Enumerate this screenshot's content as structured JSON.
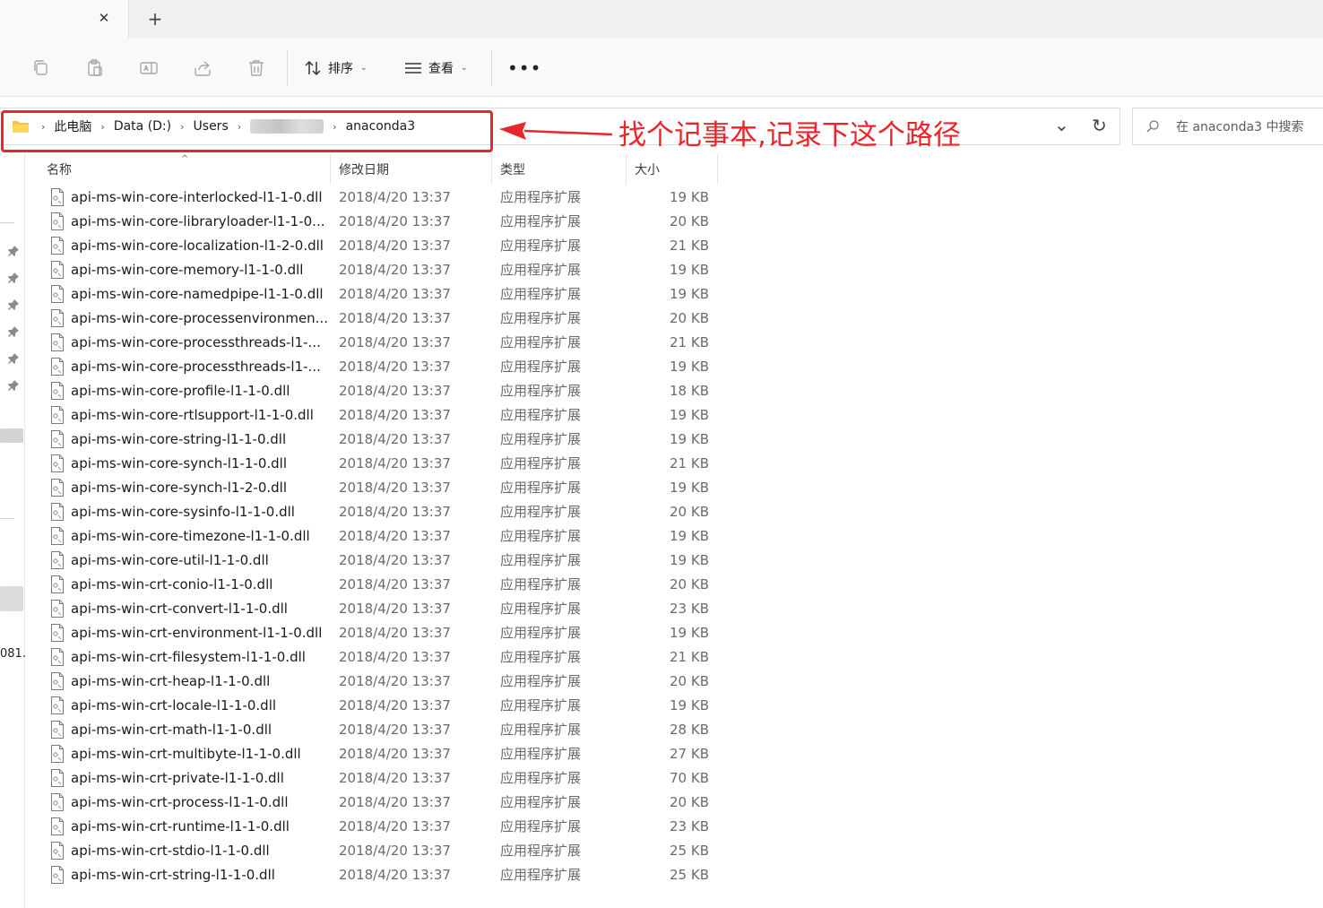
{
  "tabbar": {
    "close_glyph": "✕",
    "new_tab_glyph": "+"
  },
  "toolbar": {
    "buttons": [
      {
        "name": "copy",
        "icon": "copy-icon"
      },
      {
        "name": "paste",
        "icon": "paste-icon"
      },
      {
        "name": "rename",
        "icon": "rename-icon"
      },
      {
        "name": "share",
        "icon": "share-icon"
      },
      {
        "name": "delete",
        "icon": "trash-icon"
      }
    ],
    "sort_label": "排序",
    "view_label": "查看",
    "more_glyph": "•••"
  },
  "address": {
    "crumbs": [
      "此电脑",
      "Data (D:)",
      "Users",
      "anaconda3"
    ],
    "separator": "›",
    "chevron_glyph": "⌄",
    "refresh_glyph": "↻"
  },
  "annotation": {
    "text": "找个记事本,记录下这个路径",
    "color": "#e8262b"
  },
  "search": {
    "placeholder": "在 anaconda3 中搜索"
  },
  "nav": {
    "partial_text": "081."
  },
  "columns": {
    "name": "名称",
    "modified": "修改日期",
    "type": "类型",
    "size": "大小"
  },
  "files": [
    {
      "name": "api-ms-win-core-interlocked-l1-1-0.dll",
      "date": "2018/4/20 13:37",
      "type": "应用程序扩展",
      "size": "19 KB"
    },
    {
      "name": "api-ms-win-core-libraryloader-l1-1-0...",
      "date": "2018/4/20 13:37",
      "type": "应用程序扩展",
      "size": "20 KB"
    },
    {
      "name": "api-ms-win-core-localization-l1-2-0.dll",
      "date": "2018/4/20 13:37",
      "type": "应用程序扩展",
      "size": "21 KB"
    },
    {
      "name": "api-ms-win-core-memory-l1-1-0.dll",
      "date": "2018/4/20 13:37",
      "type": "应用程序扩展",
      "size": "19 KB"
    },
    {
      "name": "api-ms-win-core-namedpipe-l1-1-0.dll",
      "date": "2018/4/20 13:37",
      "type": "应用程序扩展",
      "size": "19 KB"
    },
    {
      "name": "api-ms-win-core-processenvironmen...",
      "date": "2018/4/20 13:37",
      "type": "应用程序扩展",
      "size": "20 KB"
    },
    {
      "name": "api-ms-win-core-processthreads-l1-...",
      "date": "2018/4/20 13:37",
      "type": "应用程序扩展",
      "size": "21 KB"
    },
    {
      "name": "api-ms-win-core-processthreads-l1-...",
      "date": "2018/4/20 13:37",
      "type": "应用程序扩展",
      "size": "19 KB"
    },
    {
      "name": "api-ms-win-core-profile-l1-1-0.dll",
      "date": "2018/4/20 13:37",
      "type": "应用程序扩展",
      "size": "18 KB"
    },
    {
      "name": "api-ms-win-core-rtlsupport-l1-1-0.dll",
      "date": "2018/4/20 13:37",
      "type": "应用程序扩展",
      "size": "19 KB"
    },
    {
      "name": "api-ms-win-core-string-l1-1-0.dll",
      "date": "2018/4/20 13:37",
      "type": "应用程序扩展",
      "size": "19 KB"
    },
    {
      "name": "api-ms-win-core-synch-l1-1-0.dll",
      "date": "2018/4/20 13:37",
      "type": "应用程序扩展",
      "size": "21 KB"
    },
    {
      "name": "api-ms-win-core-synch-l1-2-0.dll",
      "date": "2018/4/20 13:37",
      "type": "应用程序扩展",
      "size": "19 KB"
    },
    {
      "name": "api-ms-win-core-sysinfo-l1-1-0.dll",
      "date": "2018/4/20 13:37",
      "type": "应用程序扩展",
      "size": "20 KB"
    },
    {
      "name": "api-ms-win-core-timezone-l1-1-0.dll",
      "date": "2018/4/20 13:37",
      "type": "应用程序扩展",
      "size": "19 KB"
    },
    {
      "name": "api-ms-win-core-util-l1-1-0.dll",
      "date": "2018/4/20 13:37",
      "type": "应用程序扩展",
      "size": "19 KB"
    },
    {
      "name": "api-ms-win-crt-conio-l1-1-0.dll",
      "date": "2018/4/20 13:37",
      "type": "应用程序扩展",
      "size": "20 KB"
    },
    {
      "name": "api-ms-win-crt-convert-l1-1-0.dll",
      "date": "2018/4/20 13:37",
      "type": "应用程序扩展",
      "size": "23 KB"
    },
    {
      "name": "api-ms-win-crt-environment-l1-1-0.dll",
      "date": "2018/4/20 13:37",
      "type": "应用程序扩展",
      "size": "19 KB"
    },
    {
      "name": "api-ms-win-crt-filesystem-l1-1-0.dll",
      "date": "2018/4/20 13:37",
      "type": "应用程序扩展",
      "size": "21 KB"
    },
    {
      "name": "api-ms-win-crt-heap-l1-1-0.dll",
      "date": "2018/4/20 13:37",
      "type": "应用程序扩展",
      "size": "20 KB"
    },
    {
      "name": "api-ms-win-crt-locale-l1-1-0.dll",
      "date": "2018/4/20 13:37",
      "type": "应用程序扩展",
      "size": "19 KB"
    },
    {
      "name": "api-ms-win-crt-math-l1-1-0.dll",
      "date": "2018/4/20 13:37",
      "type": "应用程序扩展",
      "size": "28 KB"
    },
    {
      "name": "api-ms-win-crt-multibyte-l1-1-0.dll",
      "date": "2018/4/20 13:37",
      "type": "应用程序扩展",
      "size": "27 KB"
    },
    {
      "name": "api-ms-win-crt-private-l1-1-0.dll",
      "date": "2018/4/20 13:37",
      "type": "应用程序扩展",
      "size": "70 KB"
    },
    {
      "name": "api-ms-win-crt-process-l1-1-0.dll",
      "date": "2018/4/20 13:37",
      "type": "应用程序扩展",
      "size": "20 KB"
    },
    {
      "name": "api-ms-win-crt-runtime-l1-1-0.dll",
      "date": "2018/4/20 13:37",
      "type": "应用程序扩展",
      "size": "23 KB"
    },
    {
      "name": "api-ms-win-crt-stdio-l1-1-0.dll",
      "date": "2018/4/20 13:37",
      "type": "应用程序扩展",
      "size": "25 KB"
    },
    {
      "name": "api-ms-win-crt-string-l1-1-0.dll",
      "date": "2018/4/20 13:37",
      "type": "应用程序扩展",
      "size": "25 KB"
    }
  ]
}
